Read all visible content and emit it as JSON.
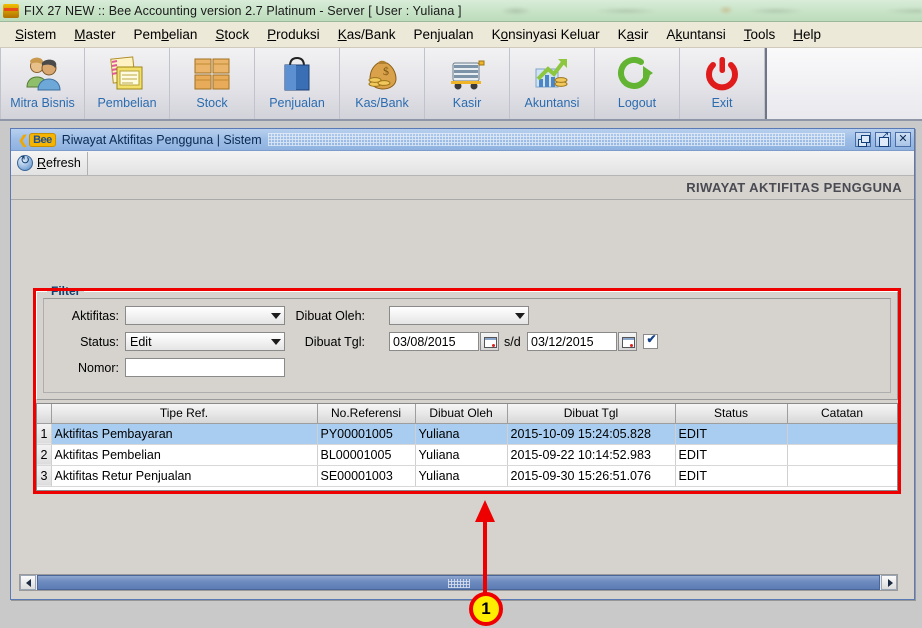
{
  "os_window": {
    "title": "FIX 27 NEW :: Bee Accounting version 2.7 Platinum - Server  [ User : Yuliana ]",
    "app_icon": "bee-app-icon"
  },
  "menubar": {
    "items": [
      {
        "label": "Sistem",
        "mnemonic": "i"
      },
      {
        "label": "Master",
        "mnemonic": "M"
      },
      {
        "label": "Pembelian",
        "mnemonic": "b"
      },
      {
        "label": "Stock",
        "mnemonic": "S"
      },
      {
        "label": "Produksi",
        "mnemonic": "P"
      },
      {
        "label": "Kas/Bank",
        "mnemonic": "K"
      },
      {
        "label": "Penjualan",
        "mnemonic": "j"
      },
      {
        "label": "Konsinyasi Keluar",
        "mnemonic": "o"
      },
      {
        "label": "Kasir",
        "mnemonic": "a"
      },
      {
        "label": "Akuntansi",
        "mnemonic": "k"
      },
      {
        "label": "Tools",
        "mnemonic": "T"
      },
      {
        "label": "Help",
        "mnemonic": "H"
      }
    ]
  },
  "toolbar": {
    "buttons": [
      {
        "label": "Mitra Bisnis",
        "icon": "two-people-icon"
      },
      {
        "label": "Pembelian",
        "icon": "ledger-book-icon"
      },
      {
        "label": "Stock",
        "icon": "boxes-icon"
      },
      {
        "label": "Penjualan",
        "icon": "shopping-bag-icon"
      },
      {
        "label": "Kas/Bank",
        "icon": "money-bag-icon"
      },
      {
        "label": "Kasir",
        "icon": "cash-register-icon"
      },
      {
        "label": "Akuntansi",
        "icon": "growth-chart-icon"
      },
      {
        "label": "Logout",
        "icon": "logout-arrow-icon"
      },
      {
        "label": "Exit",
        "icon": "power-off-icon"
      }
    ]
  },
  "mdi_window": {
    "title": "Riwayat Aktifitas Pengguna | Sistem",
    "logo": "bee-logo",
    "controls": {
      "restore": "restore-window",
      "maximize": "maximize-window",
      "close": "close-window"
    },
    "toolbar": {
      "refresh_label": "Refresh",
      "refresh_mnemonic": "R",
      "refresh_icon": "refresh-icon"
    },
    "page_title": "RIWAYAT AKTIFITAS PENGGUNA"
  },
  "filter": {
    "legend": "Filter",
    "fields": {
      "aktifitas_label": "Aktifitas:",
      "aktifitas_value": "",
      "status_label": "Status:",
      "status_value": "Edit",
      "status_options": [
        "Edit"
      ],
      "nomor_label": "Nomor:",
      "nomor_value": "",
      "dibuat_oleh_label": "Dibuat Oleh:",
      "dibuat_oleh_value": "",
      "dibuat_tgl_label": "Dibuat Tgl:",
      "tgl_from": "03/08/2015",
      "tgl_separator": "s/d",
      "tgl_to": "03/12/2015",
      "tgl_enabled_checkbox": "checked"
    }
  },
  "grid": {
    "columns": [
      "",
      "Tipe Ref.",
      "No.Referensi",
      "Dibuat Oleh",
      "Dibuat Tgl",
      "Status",
      "Catatan"
    ],
    "rows": [
      {
        "n": "1",
        "tipe_ref": "Aktifitas Pembayaran",
        "no_referensi": "PY00001005",
        "dibuat_oleh": "Yuliana",
        "dibuat_tgl": "2015-10-09 15:24:05.828",
        "status": "EDIT",
        "catatan": "",
        "selected": true
      },
      {
        "n": "2",
        "tipe_ref": "Aktifitas Pembelian",
        "no_referensi": "BL00001005",
        "dibuat_oleh": "Yuliana",
        "dibuat_tgl": "2015-09-22 10:14:52.983",
        "status": "EDIT",
        "catatan": "",
        "selected": false
      },
      {
        "n": "3",
        "tipe_ref": "Aktifitas Retur Penjualan",
        "no_referensi": "SE00001003",
        "dibuat_oleh": "Yuliana",
        "dibuat_tgl": "2015-09-30 15:26:51.076",
        "status": "EDIT",
        "catatan": "",
        "selected": false
      }
    ]
  },
  "annotation": {
    "number": "1",
    "color": "#ee0000",
    "badge_fill": "#ffee00"
  },
  "colors": {
    "highlight_box": "#ee0000",
    "selected_row": "#a8cdf0",
    "mdi_title": "#9dbde6",
    "toolbar_label": "#2b6cb0",
    "os_titlebar": "#cbe5ca"
  },
  "scrollbar": {
    "left_arrow": "scroll-left-icon",
    "right_arrow": "scroll-right-icon"
  }
}
